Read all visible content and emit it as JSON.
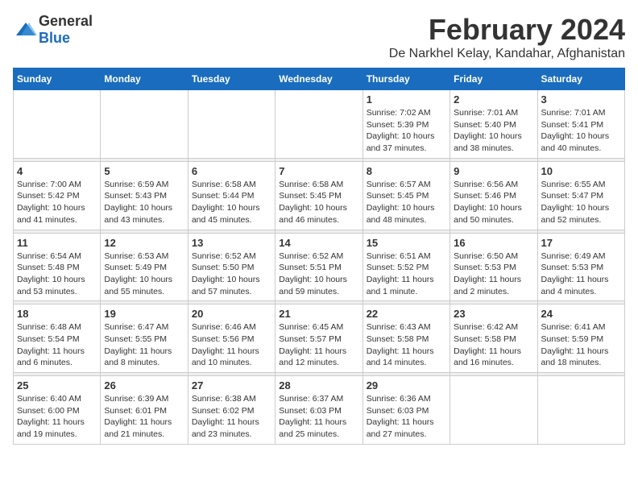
{
  "logo": {
    "text_general": "General",
    "text_blue": "Blue"
  },
  "title": "February 2024",
  "subtitle": "De Narkhel Kelay, Kandahar, Afghanistan",
  "days_of_week": [
    "Sunday",
    "Monday",
    "Tuesday",
    "Wednesday",
    "Thursday",
    "Friday",
    "Saturday"
  ],
  "weeks": [
    [
      {
        "day": "",
        "info": ""
      },
      {
        "day": "",
        "info": ""
      },
      {
        "day": "",
        "info": ""
      },
      {
        "day": "",
        "info": ""
      },
      {
        "day": "1",
        "info": "Sunrise: 7:02 AM\nSunset: 5:39 PM\nDaylight: 10 hours\nand 37 minutes."
      },
      {
        "day": "2",
        "info": "Sunrise: 7:01 AM\nSunset: 5:40 PM\nDaylight: 10 hours\nand 38 minutes."
      },
      {
        "day": "3",
        "info": "Sunrise: 7:01 AM\nSunset: 5:41 PM\nDaylight: 10 hours\nand 40 minutes."
      }
    ],
    [
      {
        "day": "4",
        "info": "Sunrise: 7:00 AM\nSunset: 5:42 PM\nDaylight: 10 hours\nand 41 minutes."
      },
      {
        "day": "5",
        "info": "Sunrise: 6:59 AM\nSunset: 5:43 PM\nDaylight: 10 hours\nand 43 minutes."
      },
      {
        "day": "6",
        "info": "Sunrise: 6:58 AM\nSunset: 5:44 PM\nDaylight: 10 hours\nand 45 minutes."
      },
      {
        "day": "7",
        "info": "Sunrise: 6:58 AM\nSunset: 5:45 PM\nDaylight: 10 hours\nand 46 minutes."
      },
      {
        "day": "8",
        "info": "Sunrise: 6:57 AM\nSunset: 5:45 PM\nDaylight: 10 hours\nand 48 minutes."
      },
      {
        "day": "9",
        "info": "Sunrise: 6:56 AM\nSunset: 5:46 PM\nDaylight: 10 hours\nand 50 minutes."
      },
      {
        "day": "10",
        "info": "Sunrise: 6:55 AM\nSunset: 5:47 PM\nDaylight: 10 hours\nand 52 minutes."
      }
    ],
    [
      {
        "day": "11",
        "info": "Sunrise: 6:54 AM\nSunset: 5:48 PM\nDaylight: 10 hours\nand 53 minutes."
      },
      {
        "day": "12",
        "info": "Sunrise: 6:53 AM\nSunset: 5:49 PM\nDaylight: 10 hours\nand 55 minutes."
      },
      {
        "day": "13",
        "info": "Sunrise: 6:52 AM\nSunset: 5:50 PM\nDaylight: 10 hours\nand 57 minutes."
      },
      {
        "day": "14",
        "info": "Sunrise: 6:52 AM\nSunset: 5:51 PM\nDaylight: 10 hours\nand 59 minutes."
      },
      {
        "day": "15",
        "info": "Sunrise: 6:51 AM\nSunset: 5:52 PM\nDaylight: 11 hours\nand 1 minute."
      },
      {
        "day": "16",
        "info": "Sunrise: 6:50 AM\nSunset: 5:53 PM\nDaylight: 11 hours\nand 2 minutes."
      },
      {
        "day": "17",
        "info": "Sunrise: 6:49 AM\nSunset: 5:53 PM\nDaylight: 11 hours\nand 4 minutes."
      }
    ],
    [
      {
        "day": "18",
        "info": "Sunrise: 6:48 AM\nSunset: 5:54 PM\nDaylight: 11 hours\nand 6 minutes."
      },
      {
        "day": "19",
        "info": "Sunrise: 6:47 AM\nSunset: 5:55 PM\nDaylight: 11 hours\nand 8 minutes."
      },
      {
        "day": "20",
        "info": "Sunrise: 6:46 AM\nSunset: 5:56 PM\nDaylight: 11 hours\nand 10 minutes."
      },
      {
        "day": "21",
        "info": "Sunrise: 6:45 AM\nSunset: 5:57 PM\nDaylight: 11 hours\nand 12 minutes."
      },
      {
        "day": "22",
        "info": "Sunrise: 6:43 AM\nSunset: 5:58 PM\nDaylight: 11 hours\nand 14 minutes."
      },
      {
        "day": "23",
        "info": "Sunrise: 6:42 AM\nSunset: 5:58 PM\nDaylight: 11 hours\nand 16 minutes."
      },
      {
        "day": "24",
        "info": "Sunrise: 6:41 AM\nSunset: 5:59 PM\nDaylight: 11 hours\nand 18 minutes."
      }
    ],
    [
      {
        "day": "25",
        "info": "Sunrise: 6:40 AM\nSunset: 6:00 PM\nDaylight: 11 hours\nand 19 minutes."
      },
      {
        "day": "26",
        "info": "Sunrise: 6:39 AM\nSunset: 6:01 PM\nDaylight: 11 hours\nand 21 minutes."
      },
      {
        "day": "27",
        "info": "Sunrise: 6:38 AM\nSunset: 6:02 PM\nDaylight: 11 hours\nand 23 minutes."
      },
      {
        "day": "28",
        "info": "Sunrise: 6:37 AM\nSunset: 6:03 PM\nDaylight: 11 hours\nand 25 minutes."
      },
      {
        "day": "29",
        "info": "Sunrise: 6:36 AM\nSunset: 6:03 PM\nDaylight: 11 hours\nand 27 minutes."
      },
      {
        "day": "",
        "info": ""
      },
      {
        "day": "",
        "info": ""
      }
    ]
  ]
}
